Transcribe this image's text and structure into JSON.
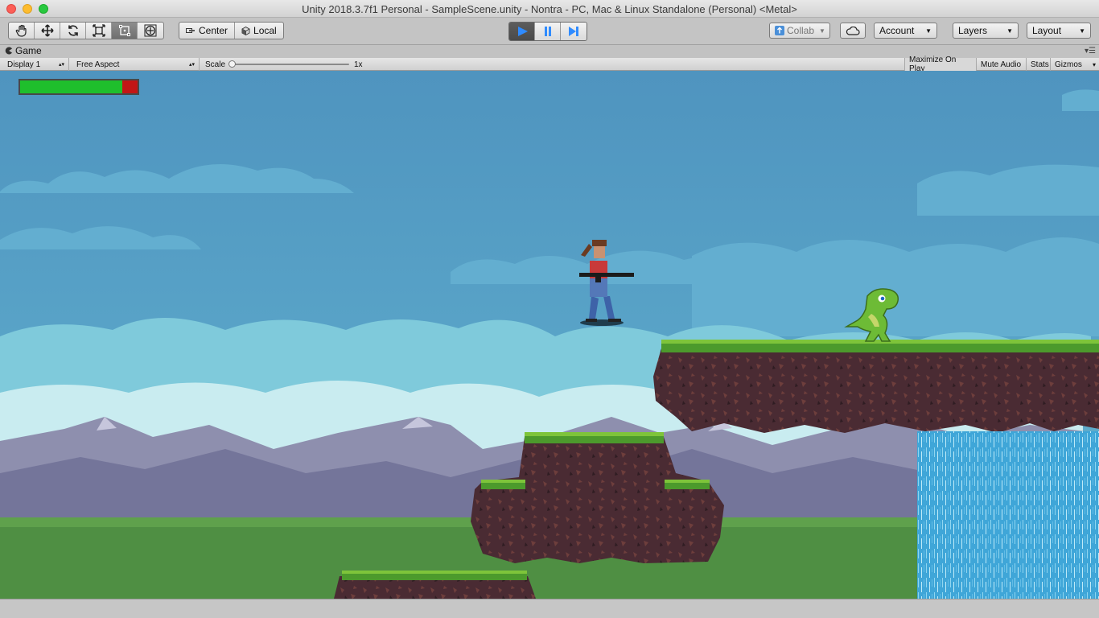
{
  "window": {
    "title": "Unity 2018.3.7f1 Personal - SampleScene.unity - Nontra - PC, Mac & Linux Standalone (Personal) <Metal>"
  },
  "toolbar": {
    "transform_tools": [
      "hand-tool-icon",
      "move-tool-icon",
      "rotate-tool-icon",
      "scale-tool-icon",
      "rect-tool-icon",
      "transform-tool-icon"
    ],
    "pivot_label": "Center",
    "space_label": "Local",
    "collab_label": "Collab",
    "account_label": "Account",
    "layers_label": "Layers",
    "layout_label": "Layout"
  },
  "game_tab": {
    "label": "Game",
    "display": "Display 1",
    "aspect": "Free Aspect",
    "scale_label": "Scale",
    "scale_value": "1x",
    "maximize_label": "Maximize On Play",
    "mute_label": "Mute Audio",
    "stats_label": "Stats",
    "gizmos_label": "Gizmos"
  },
  "game": {
    "health_fraction": 0.87,
    "colors": {
      "sky": "#5197c1",
      "health_green": "#1fbf2c",
      "health_red": "#c21616"
    }
  }
}
